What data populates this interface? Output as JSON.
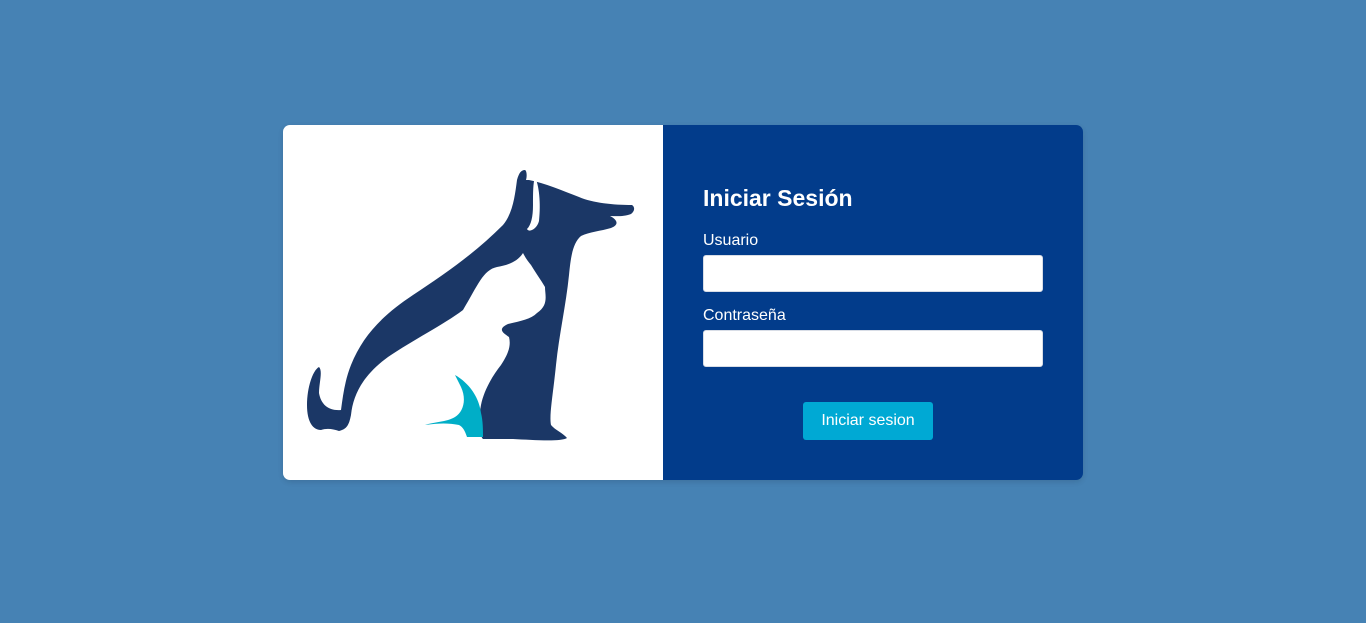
{
  "colors": {
    "page_background": "#4682b4",
    "panel_background": "#023c8b",
    "logo_primary": "#1b3766",
    "logo_accent": "#00aec7",
    "button": "#00a9d4"
  },
  "logo": {
    "icon": "dog-and-cat-silhouette-icon"
  },
  "login": {
    "title": "Iniciar Sesión",
    "username_label": "Usuario",
    "username_value": "",
    "password_label": "Contraseña",
    "password_value": "",
    "submit_label": "Iniciar sesion"
  }
}
